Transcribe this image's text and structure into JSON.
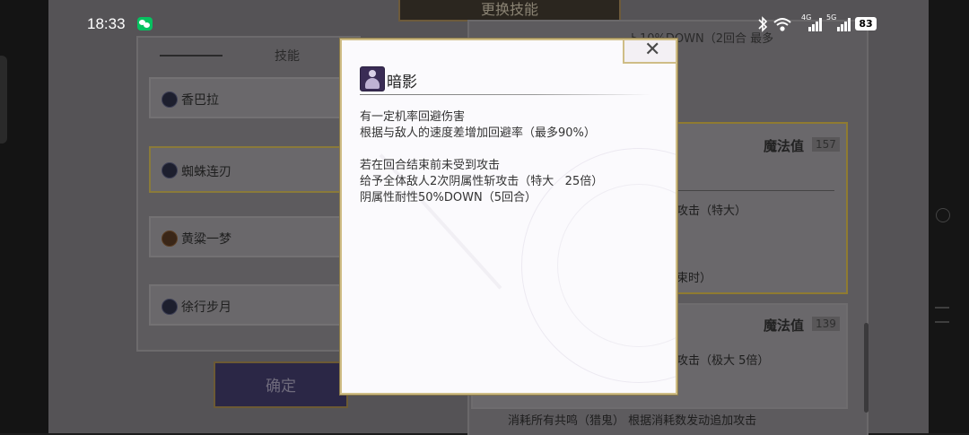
{
  "status_bar": {
    "time": "18:33",
    "battery": "83",
    "icons": [
      "wechat-icon",
      "bluetooth-icon",
      "wifi-icon",
      "4g-signal-icon",
      "5g-signal-icon"
    ],
    "network_4g": "4G",
    "network_5g": "5G"
  },
  "screen": {
    "title": "更换技能",
    "skills_header": "技能",
    "skills": [
      {
        "name": "香巴拉"
      },
      {
        "name": "蜘蛛连刃"
      },
      {
        "name": "黄粱一梦"
      },
      {
        "name": "徐行步月"
      }
    ],
    "confirm_label": "确定",
    "detail": {
      "top_text": "…………………………ト10%DOWN（2回合  最多",
      "card1_mp_label": "魔法值",
      "card1_mp_value": "157",
      "card1_line1": "攻击（特大）",
      "card1_line2": "束时）",
      "card2_mp_label": "魔法值",
      "card2_mp_value": "139",
      "card2_line1": "攻击（极大  5倍）",
      "bottom_text": "消耗所有共鸣（猎鬼） 根据消耗数发动追加攻击"
    }
  },
  "modal": {
    "title": "暗影",
    "close_symbol": "✕",
    "description": [
      "有一定机率回避伤害",
      "根据与敌人的速度差增加回避率（最多90%）",
      "",
      "若在回合结束前未受到攻击",
      "给予全体敌人2次阴属性斩攻击（特大   25倍）",
      "阴属性耐性50%DOWN（5回合）"
    ]
  },
  "colors": {
    "modal_border": "#cfbd86",
    "modal_bg": "#fbfafd",
    "dim_overlay": "#555356",
    "highlight_border": "#8f7b31"
  }
}
